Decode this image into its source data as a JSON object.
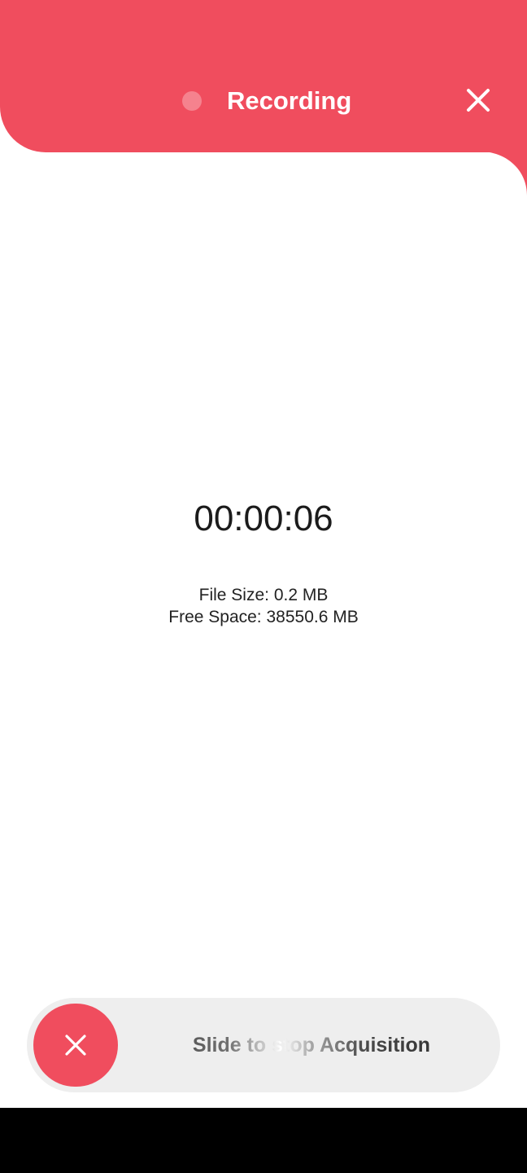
{
  "header": {
    "title": "Recording",
    "close_icon": "close-icon",
    "dot_icon": "recording-dot-icon",
    "background_color": "#f04d5e",
    "dot_color": "#f5828e"
  },
  "recording": {
    "elapsed_time": "00:00:06",
    "file_size": "File Size: 0.2 MB",
    "free_space": "Free Space: 38550.6 MB"
  },
  "slider": {
    "label": "Slide to stop Acquisition",
    "handle_icon": "close-icon",
    "track_color": "#eeeeee",
    "handle_color": "#f04d5e"
  }
}
